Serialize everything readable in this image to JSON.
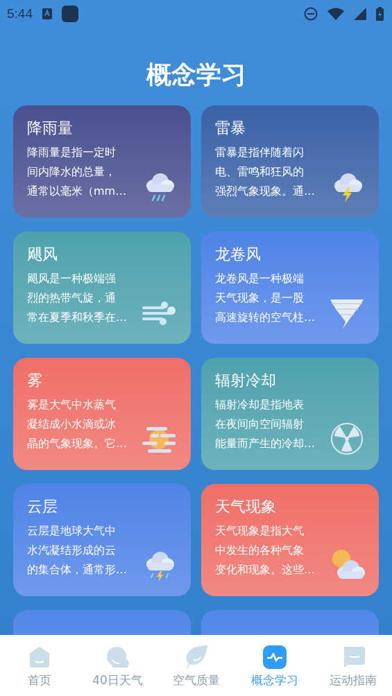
{
  "status_bar": {
    "time": "5:44"
  },
  "title": "概念学习",
  "cards": [
    {
      "title": "降雨量",
      "description": [
        "降雨量是指一定时",
        "间内降水的总量，",
        "通常以毫米（mm…"
      ],
      "kind": "rain",
      "color": "#4a508f"
    },
    {
      "title": "雷暴",
      "description": [
        "雷暴是指伴随着闪",
        "电、雷鸣和狂风的",
        "强烈气象现象。通…"
      ],
      "kind": "thunder",
      "color": "#3a62a8"
    },
    {
      "title": "飓风",
      "description": [
        "飓风是一种极端强",
        "烈的热带气旋，通",
        "常在夏季和秋季在…"
      ],
      "kind": "wind",
      "color": "#4ea2ad"
    },
    {
      "title": "龙卷风",
      "description": [
        "龙卷风是一种极端",
        "天气现象，是一股",
        "高速旋转的空气柱…"
      ],
      "kind": "tornado",
      "color": "#5083e8"
    },
    {
      "title": "雾",
      "description": [
        "雾是大气中水蒸气",
        "凝结成小水滴或冰",
        "晶的气象现象。它…"
      ],
      "kind": "fog",
      "color": "#ef6f67"
    },
    {
      "title": "辐射冷却",
      "description": [
        "辐射冷却是指地表",
        "在夜间向空间辐射",
        "能量而产生的冷却…"
      ],
      "kind": "radiation",
      "color": "#4ea2ad"
    },
    {
      "title": "云层",
      "description": [
        "云层是地球大气中",
        "水汽凝结形成的云",
        "的集合体，通常形…"
      ],
      "kind": "storm",
      "color": "#5083e8"
    },
    {
      "title": "天气现象",
      "description": [
        "天气现象是指大气",
        "中发生的各种气象",
        "变化和现象。这些…"
      ],
      "kind": "suncloud",
      "color": "#ef6f67"
    },
    {
      "kind": "none",
      "color": "#5286e8"
    },
    {
      "kind": "none",
      "color": "#5286e8"
    }
  ],
  "nav": [
    {
      "label": "首页",
      "kind": "home",
      "selected": false
    },
    {
      "label": "40日天气",
      "kind": "weather",
      "selected": false
    },
    {
      "label": "空气质量",
      "kind": "leaf",
      "selected": false
    },
    {
      "label": "概念学习",
      "kind": "pulse",
      "selected": true
    },
    {
      "label": "运动指南",
      "kind": "chat",
      "selected": false
    }
  ]
}
